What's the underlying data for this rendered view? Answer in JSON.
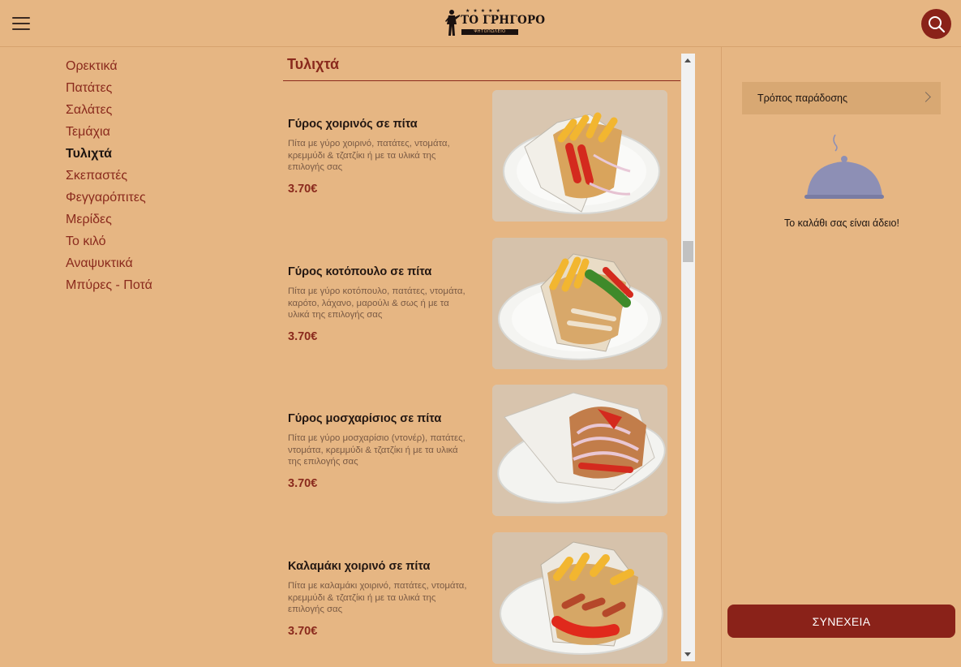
{
  "header": {
    "logo_text": "ΤΟ ΓΡΗΓΟΡΟ",
    "logo_subtext": "ΨΗΤΟΠΩΛΕΙΟ",
    "menu_icon": "hamburger-icon",
    "search_icon": "search-icon"
  },
  "categories": [
    {
      "label": "Ορεκτικά",
      "active": false
    },
    {
      "label": "Πατάτες",
      "active": false
    },
    {
      "label": "Σαλάτες",
      "active": false
    },
    {
      "label": "Τεμάχια",
      "active": false
    },
    {
      "label": "Τυλιχτά",
      "active": true
    },
    {
      "label": "Σκεπαστές",
      "active": false
    },
    {
      "label": "Φεγγαρόπιτες",
      "active": false
    },
    {
      "label": "Μερίδες",
      "active": false
    },
    {
      "label": "Το κιλό",
      "active": false
    },
    {
      "label": "Αναψυκτικά",
      "active": false
    },
    {
      "label": "Μπύρες - Ποτά",
      "active": false
    }
  ],
  "section": {
    "title": "Τυλιχτά"
  },
  "products": [
    {
      "name": "Γύρος χοιρινός σε πίτα",
      "description": "Πίτα με γύρο χοιρινό, πατάτες, ντομάτα, κρεμμύδι & τζατζίκι ή με τα υλικά της επιλογής σας",
      "price": "3.70€"
    },
    {
      "name": "Γύρος κοτόπουλο σε πίτα",
      "description": "Πίτα με γύρο κοτόπουλο, πατάτες, ντομάτα, καρότο, λάχανο, μαρούλι & σως ή με τα υλικά της επιλογής σας",
      "price": "3.70€"
    },
    {
      "name": "Γύρος μοσχαρίσιος σε πίτα",
      "description": "Πίτα με γύρο μοσχαρίσιο (ντονέρ), πατάτες, ντομάτα, κρεμμύδι & τζατζίκι ή με τα υλικά της επιλογής σας",
      "price": "3.70€"
    },
    {
      "name": "Καλαμάκι χοιρινό σε πίτα",
      "description": "Πίτα με καλαμάκι χοιρινό, πατάτες, ντομάτα, κρεμμύδι & τζατζίκι ή με τα υλικά της επιλογής σας",
      "price": "3.70€"
    }
  ],
  "cart": {
    "delivery_label": "Τρόπος παράδοσης",
    "empty_message": "Το καλάθι σας είναι άδειο!",
    "continue_label": "ΣΥΝΕΧΕΙΑ"
  },
  "colors": {
    "background": "#e6b683",
    "accent": "#8a2219",
    "link": "#8a2a1d"
  }
}
